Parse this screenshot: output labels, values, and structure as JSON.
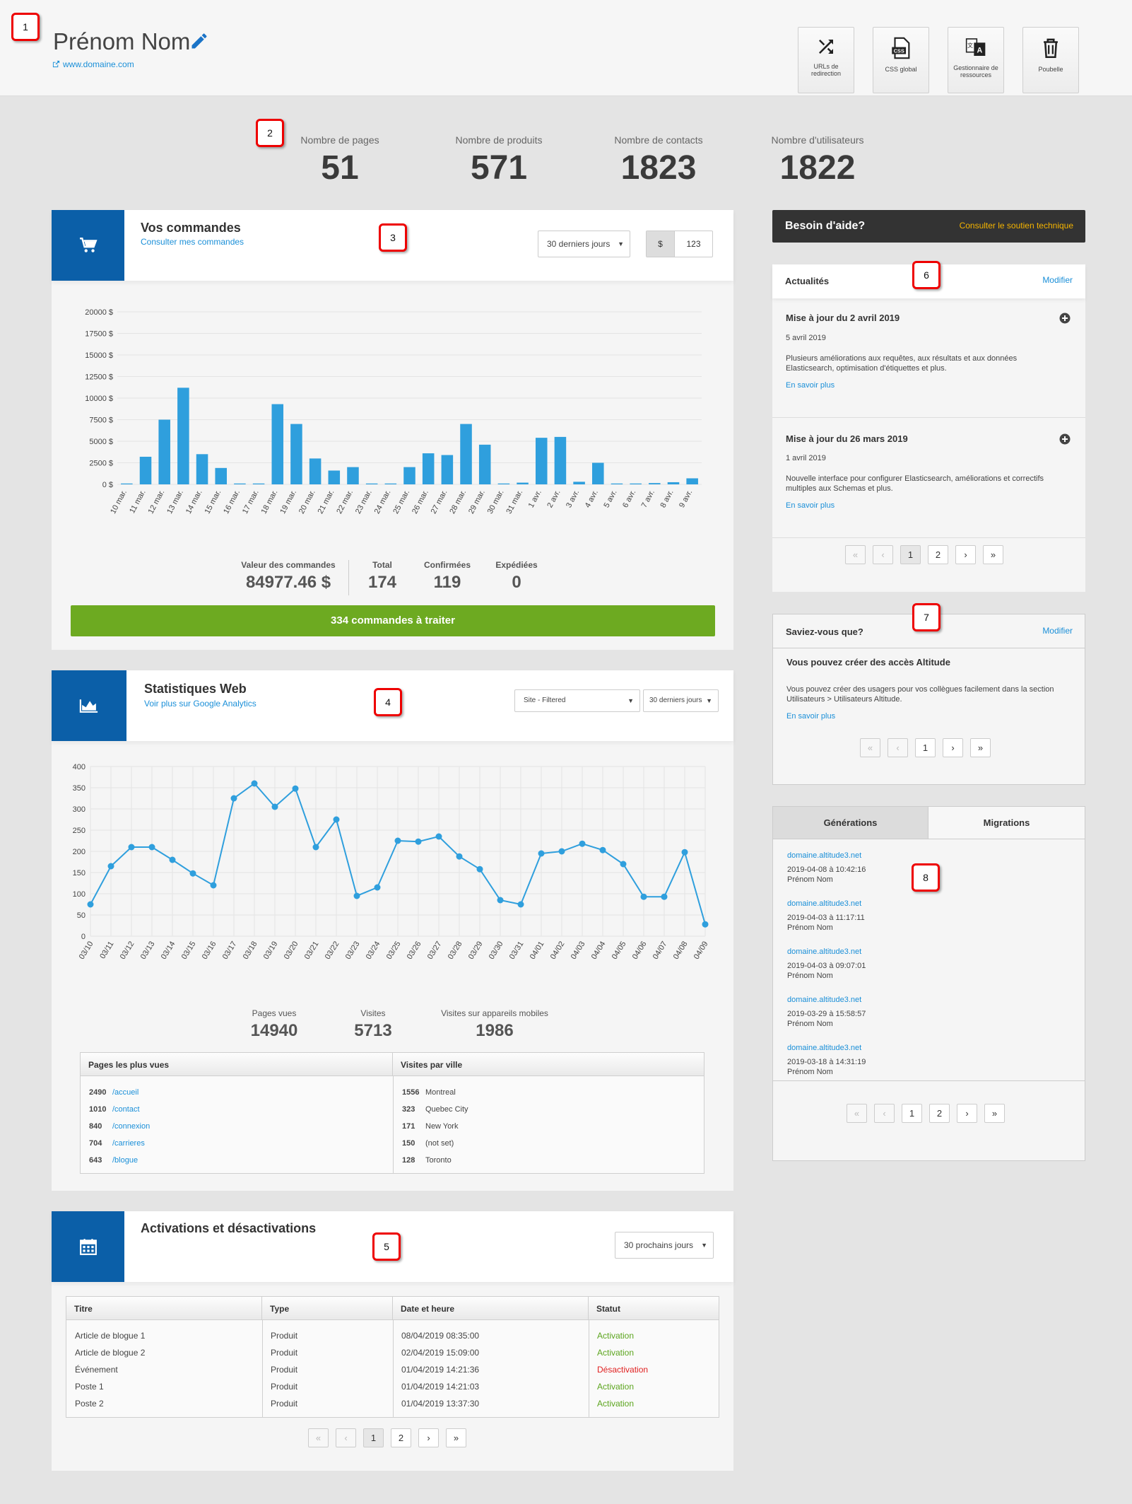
{
  "header": {
    "name": "Prénom Nom",
    "site": "www.domaine.com",
    "tools": [
      {
        "label": "URLs de redirection",
        "icon": "shuffle-icon"
      },
      {
        "label": "CSS global",
        "icon": "css-file-icon"
      },
      {
        "label": "Gestionnaire de ressources",
        "icon": "translate-icon"
      },
      {
        "label": "Poubelle",
        "icon": "trash-icon"
      }
    ]
  },
  "badges": [
    "1",
    "2",
    "3",
    "4",
    "5",
    "6",
    "7",
    "8"
  ],
  "stats": [
    {
      "label": "Nombre de pages",
      "value": "51"
    },
    {
      "label": "Nombre de produits",
      "value": "571"
    },
    {
      "label": "Nombre de contacts",
      "value": "1823"
    },
    {
      "label": "Nombre d'utilisateurs",
      "value": "1822"
    }
  ],
  "orders": {
    "title": "Vos commandes",
    "link": "Consulter mes commandes",
    "period": "30 derniers jours",
    "toggle_currency": "$",
    "toggle_count": "123",
    "summary": [
      {
        "label": "Valeur des commandes",
        "value": "84977.46 $"
      },
      {
        "label": "Total",
        "value": "174"
      },
      {
        "label": "Confirmées",
        "value": "119"
      },
      {
        "label": "Expédiées",
        "value": "0"
      }
    ],
    "cta": "334 commandes à traiter"
  },
  "web": {
    "title": "Statistiques Web",
    "link": "Voir plus sur Google Analytics",
    "site_filter": "Site - Filtered",
    "period": "30 derniers jours",
    "summary": [
      {
        "label": "Pages vues",
        "value": "14940"
      },
      {
        "label": "Visites",
        "value": "5713"
      },
      {
        "label": "Visites sur appareils mobiles",
        "value": "1986"
      }
    ],
    "top_pages_header": "Pages les plus vues",
    "top_pages": [
      {
        "count": "2490",
        "path": "/accueil"
      },
      {
        "count": "1010",
        "path": "/contact"
      },
      {
        "count": "840",
        "path": "/connexion"
      },
      {
        "count": "704",
        "path": "/carrieres"
      },
      {
        "count": "643",
        "path": "/blogue"
      }
    ],
    "cities_header": "Visites par ville",
    "cities": [
      {
        "count": "1556",
        "city": "Montreal"
      },
      {
        "count": "323",
        "city": "Quebec City"
      },
      {
        "count": "171",
        "city": "New York"
      },
      {
        "count": "150",
        "city": "(not set)"
      },
      {
        "count": "128",
        "city": "Toronto"
      }
    ]
  },
  "activations": {
    "title": "Activations et désactivations",
    "period": "30 prochains jours",
    "columns": [
      "Titre",
      "Type",
      "Date et heure",
      "Statut"
    ],
    "rows": [
      {
        "title": "Article de blogue 1",
        "type": "Produit",
        "date": "08/04/2019 08:35:00",
        "status": "Activation",
        "color": "#5ca51e"
      },
      {
        "title": "Article de blogue 2",
        "type": "Produit",
        "date": "02/04/2019 15:09:00",
        "status": "Activation",
        "color": "#5ca51e"
      },
      {
        "title": "Événement",
        "type": "Produit",
        "date": "01/04/2019 14:21:36",
        "status": "Désactivation",
        "color": "#e02020"
      },
      {
        "title": "Poste 1",
        "type": "Produit",
        "date": "01/04/2019 14:21:03",
        "status": "Activation",
        "color": "#5ca51e"
      },
      {
        "title": "Poste 2",
        "type": "Produit",
        "date": "01/04/2019 13:37:30",
        "status": "Activation",
        "color": "#5ca51e"
      }
    ],
    "pages": [
      "1",
      "2"
    ]
  },
  "help": {
    "title": "Besoin d'aide?",
    "link": "Consulter le soutien technique"
  },
  "news": {
    "title": "Actualités",
    "edit": "Modifier",
    "items": [
      {
        "title": "Mise à jour du 2 avril 2019",
        "date": "5 avril 2019",
        "body": "Plusieurs améliorations aux requêtes, aux résultats et aux données Elasticsearch, optimisation d'étiquettes et plus.",
        "more": "En savoir plus"
      },
      {
        "title": "Mise à jour du 26 mars 2019",
        "date": "1 avril 2019",
        "body": "Nouvelle interface pour configurer Elasticsearch, améliorations et correctifs multiples aux Schemas et plus.",
        "more": "En savoir plus"
      }
    ],
    "pages": [
      "1",
      "2"
    ]
  },
  "tips": {
    "title": "Saviez-vous que?",
    "edit": "Modifier",
    "heading": "Vous pouvez créer des accès Altitude",
    "body": "Vous pouvez créer des usagers pour vos collègues facilement dans la section Utilisateurs > Utilisateurs Altitude.",
    "more": "En savoir plus",
    "pages": [
      "1"
    ]
  },
  "builds": {
    "tabs": [
      "Générations",
      "Migrations"
    ],
    "items": [
      {
        "domain": "domaine.altitude3.net",
        "date": "2019-04-08 à 10:42:16",
        "user": "Prénom Nom"
      },
      {
        "domain": "domaine.altitude3.net",
        "date": "2019-04-03 à 11:17:11",
        "user": "Prénom Nom"
      },
      {
        "domain": "domaine.altitude3.net",
        "date": "2019-04-03 à 09:07:01",
        "user": "Prénom Nom"
      },
      {
        "domain": "domaine.altitude3.net",
        "date": "2019-03-29 à 15:58:57",
        "user": "Prénom Nom"
      },
      {
        "domain": "domaine.altitude3.net",
        "date": "2019-03-18 à 14:31:19",
        "user": "Prénom Nom"
      }
    ],
    "pages": [
      "1",
      "2"
    ]
  },
  "chart_data": [
    {
      "type": "bar",
      "categories": [
        "10 mar.",
        "11 mar.",
        "12 mar.",
        "13 mar.",
        "14 mar.",
        "15 mar.",
        "16 mar.",
        "17 mar.",
        "18 mar.",
        "19 mar.",
        "20 mar.",
        "21 mar.",
        "22 mar.",
        "23 mar.",
        "24 mar.",
        "25 mar.",
        "26 mar.",
        "27 mar.",
        "28 mar.",
        "29 mar.",
        "30 mar.",
        "31 mar.",
        "1 avr.",
        "2 avr.",
        "3 avr.",
        "4 avr.",
        "5 avr.",
        "6 avr.",
        "7 avr.",
        "8 avr.",
        "9 avr."
      ],
      "values": [
        100,
        3200,
        7500,
        11200,
        3500,
        1900,
        100,
        100,
        9300,
        7000,
        3000,
        1600,
        2000,
        100,
        100,
        2000,
        3600,
        3400,
        7000,
        4600,
        100,
        200,
        5400,
        5500,
        300,
        2500,
        100,
        100,
        150,
        250,
        700
      ],
      "ylim": [
        0,
        20000
      ],
      "yticks": [
        "0 $",
        "2500 $",
        "5000 $",
        "7500 $",
        "10000 $",
        "12500 $",
        "15000 $",
        "17500 $",
        "20000 $"
      ],
      "color": "#2f9fdd",
      "grid": true
    },
    {
      "type": "line",
      "categories": [
        "03/10",
        "03/11",
        "03/12",
        "03/13",
        "03/14",
        "03/15",
        "03/16",
        "03/17",
        "03/18",
        "03/19",
        "03/20",
        "03/21",
        "03/22",
        "03/23",
        "03/24",
        "03/25",
        "03/26",
        "03/27",
        "03/28",
        "03/29",
        "03/30",
        "03/31",
        "04/01",
        "04/02",
        "04/03",
        "04/04",
        "04/05",
        "04/06",
        "04/07",
        "04/08",
        "04/09"
      ],
      "values": [
        75,
        165,
        210,
        210,
        180,
        148,
        120,
        325,
        360,
        305,
        348,
        210,
        275,
        95,
        115,
        225,
        223,
        235,
        188,
        158,
        85,
        75,
        195,
        200,
        218,
        203,
        170,
        93,
        93,
        198,
        28
      ],
      "ylim": [
        0,
        400
      ],
      "yticks": [
        "0",
        "50",
        "100",
        "150",
        "200",
        "250",
        "300",
        "350",
        "400"
      ],
      "color": "#2f9fdd",
      "grid": true
    }
  ]
}
